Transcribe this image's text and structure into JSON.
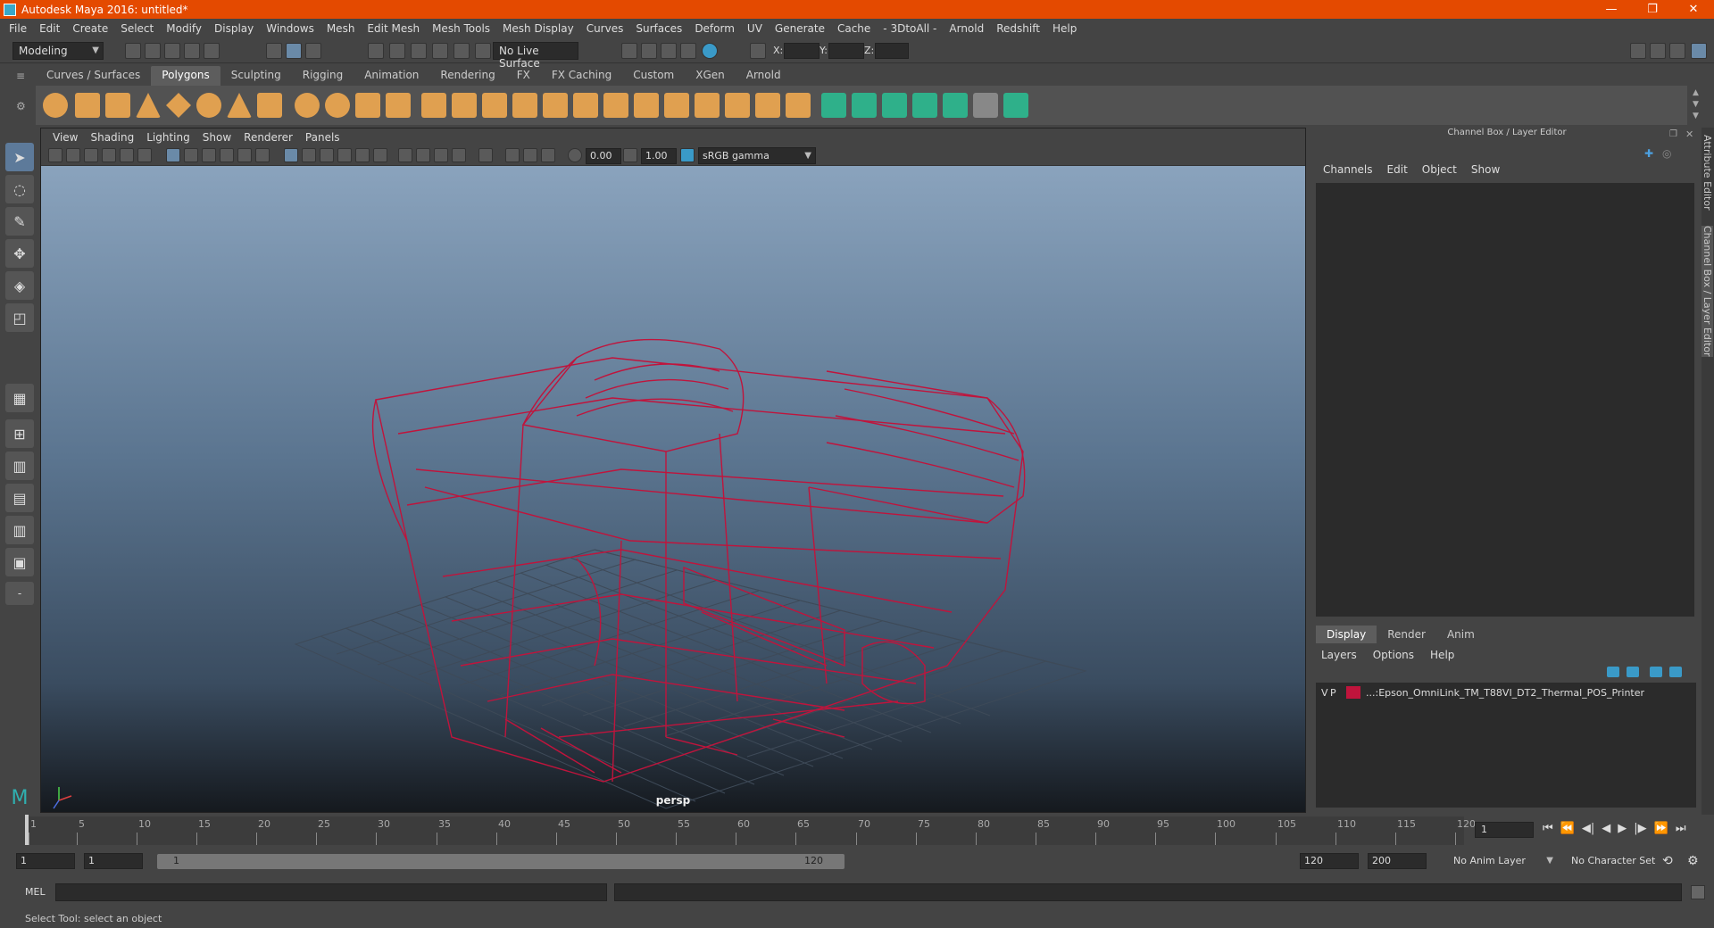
{
  "window": {
    "title": "Autodesk Maya 2016: untitled*",
    "controls": [
      "—",
      "❐",
      "✕"
    ]
  },
  "menubar": [
    "File",
    "Edit",
    "Create",
    "Select",
    "Modify",
    "Display",
    "Windows",
    "Mesh",
    "Edit Mesh",
    "Mesh Tools",
    "Mesh Display",
    "Curves",
    "Surfaces",
    "Deform",
    "UV",
    "Generate",
    "Cache",
    "- 3DtoAll -",
    "Arnold",
    "Redshift",
    "Help"
  ],
  "statusline": {
    "mode": "Modeling",
    "live_surface": "No Live Surface",
    "x_label": "X:",
    "y_label": "Y:",
    "z_label": "Z:"
  },
  "shelf_tabs": [
    "Curves / Surfaces",
    "Polygons",
    "Sculpting",
    "Rigging",
    "Animation",
    "Rendering",
    "FX",
    "FX Caching",
    "Custom",
    "XGen",
    "Arnold"
  ],
  "shelf_active": "Polygons",
  "viewport": {
    "menu": [
      "View",
      "Shading",
      "Lighting",
      "Show",
      "Renderer",
      "Panels"
    ],
    "exposure": "0.00",
    "gamma": "1.00",
    "color_space": "sRGB gamma",
    "camera_label": "persp"
  },
  "channel_box": {
    "header": "Channel Box / Layer Editor",
    "menu": [
      "Channels",
      "Edit",
      "Object",
      "Show"
    ],
    "layer_tabs": [
      "Display",
      "Render",
      "Anim"
    ],
    "layer_active": "Display",
    "layer_menu": [
      "Layers",
      "Options",
      "Help"
    ],
    "layer_row": {
      "v": "V",
      "p": "P",
      "name": "...:Epson_OmniLink_TM_T88VI_DT2_Thermal_POS_Printer"
    }
  },
  "side_tabs": [
    "Attribute Editor",
    "Channel Box / Layer Editor"
  ],
  "timeline": {
    "ticks": [
      1,
      5,
      10,
      15,
      20,
      25,
      30,
      35,
      40,
      45,
      50,
      55,
      60,
      65,
      70,
      75,
      80,
      85,
      90,
      95,
      100,
      105,
      110,
      115,
      120
    ],
    "current_frame": "1"
  },
  "range": {
    "start": "1",
    "playback_start": "1",
    "slider_start": "1",
    "slider_end": "120",
    "playback_end": "120",
    "end": "200",
    "anim_layer": "No Anim Layer",
    "character_set": "No Character Set"
  },
  "cmdline": {
    "label": "MEL"
  },
  "helpline": "Select Tool: select an object",
  "colors": {
    "titlebar": "#e44a00",
    "wireframe": "#c0143c",
    "shelf_icon": "#e0a050",
    "shelf_icon_green": "#2fb08a"
  }
}
